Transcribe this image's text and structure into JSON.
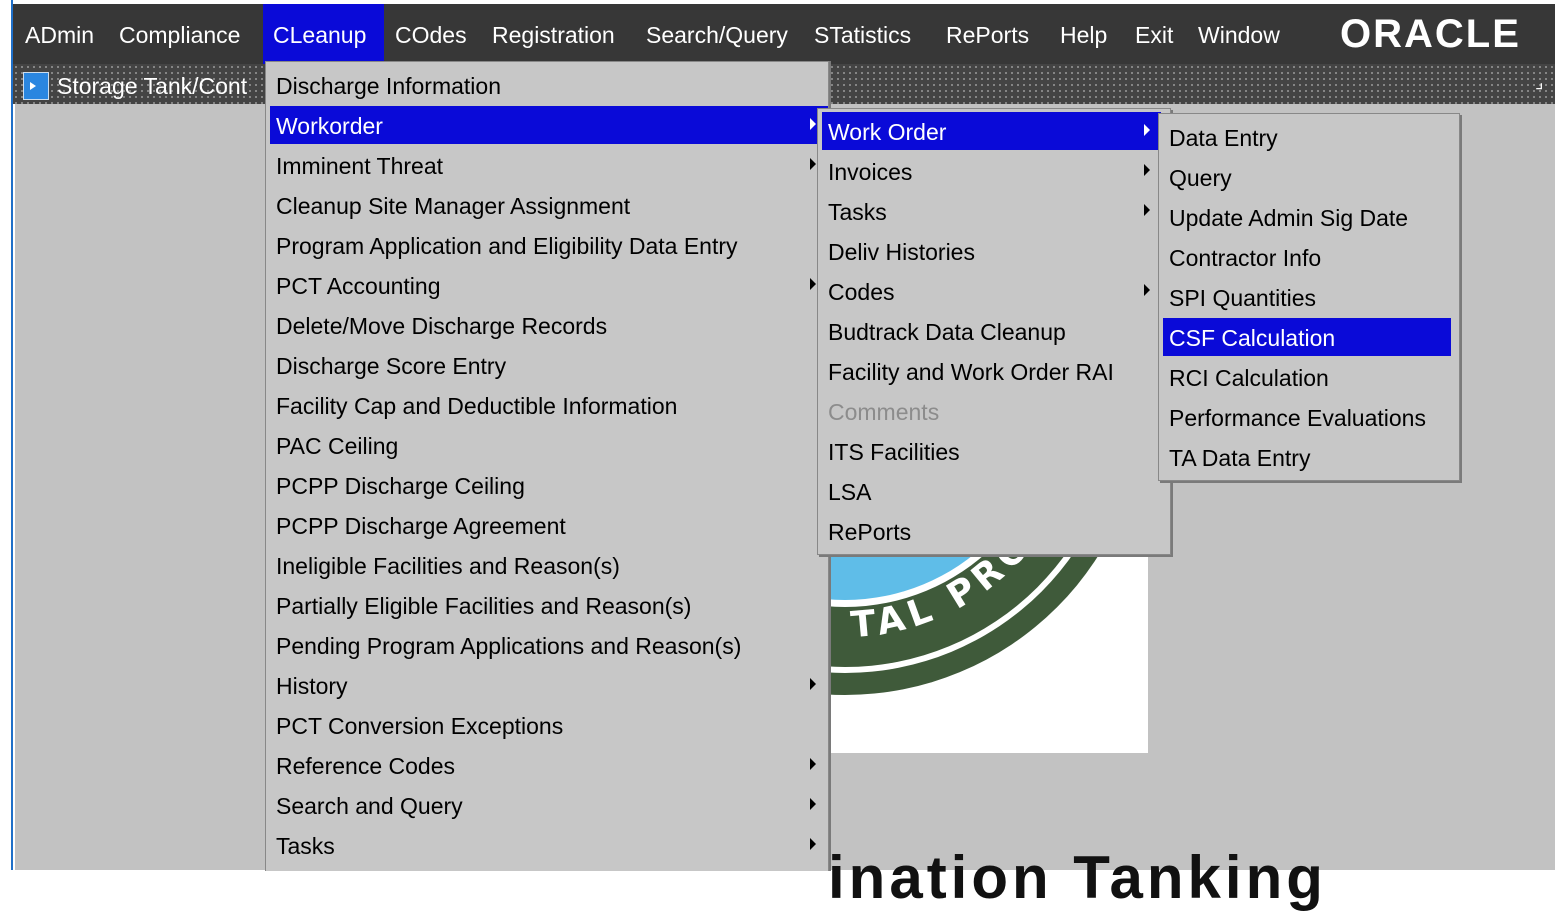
{
  "menubar": {
    "items": [
      {
        "label": "ADmin",
        "active": false
      },
      {
        "label": "Compliance",
        "active": false
      },
      {
        "label": "CLeanup",
        "active": true
      },
      {
        "label": "COdes",
        "active": false
      },
      {
        "label": "Registration",
        "active": false
      },
      {
        "label": "Search/Query",
        "active": false
      },
      {
        "label": "STatistics",
        "active": false
      },
      {
        "label": "RePorts",
        "active": false
      },
      {
        "label": "Help",
        "active": false
      },
      {
        "label": "Exit",
        "active": false
      },
      {
        "label": "Window",
        "active": false
      }
    ],
    "logo": "ORACLE"
  },
  "window": {
    "title": "Storage Tank/Cont"
  },
  "cleanup_menu": {
    "items": [
      {
        "label": "Discharge Information",
        "submenu": false
      },
      {
        "label": "Workorder",
        "submenu": true,
        "highlighted": true
      },
      {
        "label": "Imminent Threat",
        "submenu": true
      },
      {
        "label": "Cleanup Site Manager Assignment",
        "submenu": false
      },
      {
        "label": "Program Application and Eligibility Data Entry",
        "submenu": false
      },
      {
        "label": "PCT Accounting",
        "submenu": true
      },
      {
        "label": "Delete/Move Discharge Records",
        "submenu": false
      },
      {
        "label": "Discharge Score Entry",
        "submenu": false
      },
      {
        "label": "Facility Cap and Deductible Information",
        "submenu": false
      },
      {
        "label": "PAC Ceiling",
        "submenu": false
      },
      {
        "label": "PCPP Discharge Ceiling",
        "submenu": false
      },
      {
        "label": "PCPP Discharge Agreement",
        "submenu": false
      },
      {
        "label": "Ineligible Facilities and Reason(s)",
        "submenu": false
      },
      {
        "label": "Partially Eligible Facilities and Reason(s)",
        "submenu": false
      },
      {
        "label": "Pending Program Applications and Reason(s)",
        "submenu": false
      },
      {
        "label": "History",
        "submenu": true
      },
      {
        "label": "PCT Conversion Exceptions",
        "submenu": false
      },
      {
        "label": "Reference Codes",
        "submenu": true
      },
      {
        "label": "Search and Query",
        "submenu": true
      },
      {
        "label": "Tasks",
        "submenu": true
      }
    ]
  },
  "workorder_menu": {
    "items": [
      {
        "label": "Work Order",
        "submenu": true,
        "highlighted": true
      },
      {
        "label": "Invoices",
        "submenu": true
      },
      {
        "label": "Tasks",
        "submenu": true
      },
      {
        "label": "Deliv Histories",
        "submenu": false
      },
      {
        "label": "Codes",
        "submenu": true
      },
      {
        "label": "Budtrack Data Cleanup",
        "submenu": false
      },
      {
        "label": "Facility and Work Order RAI",
        "submenu": false
      },
      {
        "label": "Comments",
        "submenu": false,
        "disabled": true
      },
      {
        "label": "ITS Facilities",
        "submenu": false
      },
      {
        "label": "LSA",
        "submenu": false
      },
      {
        "label": "RePorts",
        "submenu": false
      }
    ]
  },
  "work_order_menu": {
    "items": [
      {
        "label": "Data Entry"
      },
      {
        "label": "Query"
      },
      {
        "label": "Update Admin Sig Date"
      },
      {
        "label": "Contractor Info"
      },
      {
        "label": "SPI Quantities"
      },
      {
        "label": "CSF Calculation",
        "highlighted": true
      },
      {
        "label": "RCI Calculation"
      },
      {
        "label": "Performance Evaluations"
      },
      {
        "label": "TA Data Entry"
      }
    ]
  },
  "background": {
    "seal_text": "TAL PROTECTI",
    "partial_text": "ination Tanking"
  },
  "colors": {
    "menubar_bg": "#373737",
    "highlight": "#0a0ad8",
    "menu_bg": "#c7c7c7",
    "workspace_bg": "#c2c2c2",
    "seal_blue": "#5fbde8",
    "seal_green": "#3f5a3a"
  }
}
